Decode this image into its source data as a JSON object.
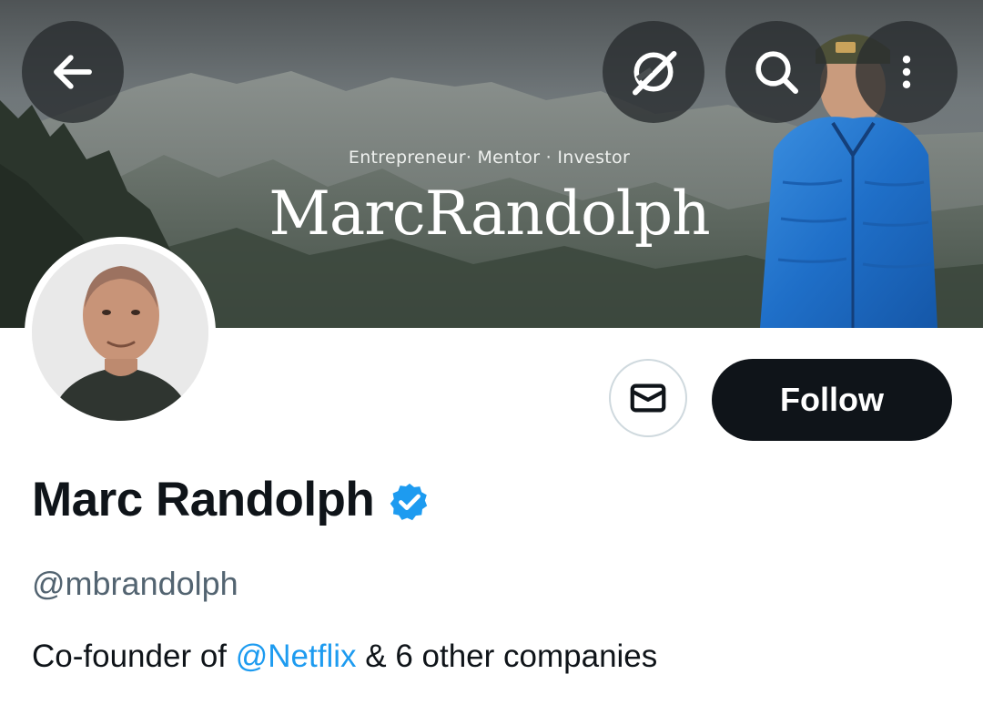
{
  "banner": {
    "subtitle": "Entrepreneur· Mentor · Investor",
    "name": "MarcRandolph"
  },
  "header": {
    "back_icon": "arrow-left-icon",
    "grok_icon": "grok-icon",
    "search_icon": "search-icon",
    "more_icon": "more-vertical-icon"
  },
  "profile": {
    "display_name": "Marc Randolph",
    "verified": true,
    "handle": "@mbrandolph",
    "bio": {
      "prefix": "Co-founder of ",
      "mention": "@Netflix",
      "suffix": " & 6 other companies"
    }
  },
  "actions": {
    "message_icon": "mail-icon",
    "follow_label": "Follow"
  },
  "colors": {
    "follow_bg": "#0f1419",
    "verified_blue": "#1d9bf0",
    "mention_blue": "#1d9bf0",
    "handle_gray": "#536471"
  }
}
